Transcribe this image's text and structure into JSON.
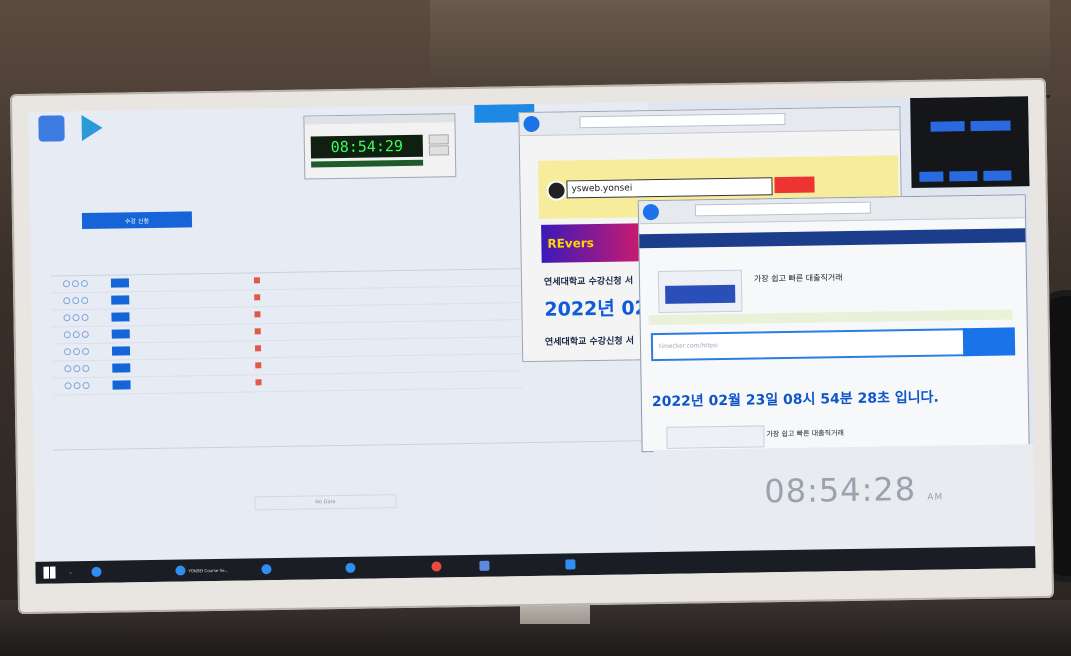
{
  "left_app": {
    "enroll_button": "수강 신청",
    "table_rows": 7,
    "no_data": "No Data"
  },
  "clock_widget": {
    "time": "08:54:29"
  },
  "browser_top": {
    "url_text": "ysweb.yonsei",
    "ad_text": "REvers",
    "title_line1": "연세대학교 수강신청 서",
    "title_line2": "2022년 02",
    "title_line3": "연세대학교 수강신청 서"
  },
  "browser_timecheck": {
    "search_placeholder": "timecker.com/https:",
    "ad_title": "가장 쉽고 빠른 대출직거래",
    "current_time_sentence": "2022년 02월 23일 08시 54분 28초 입니다.",
    "ad_title_2": "가장 쉽고 빠른 대출직거래"
  },
  "big_clock": {
    "time": "08:54:28",
    "ampm": "AM"
  },
  "taskbar": {
    "items": [
      "YONSEI Course Se..."
    ]
  },
  "colors": {
    "accent_blue": "#1565d8",
    "lcd_green": "#39ff5a",
    "time_blue": "#0f56c8"
  }
}
